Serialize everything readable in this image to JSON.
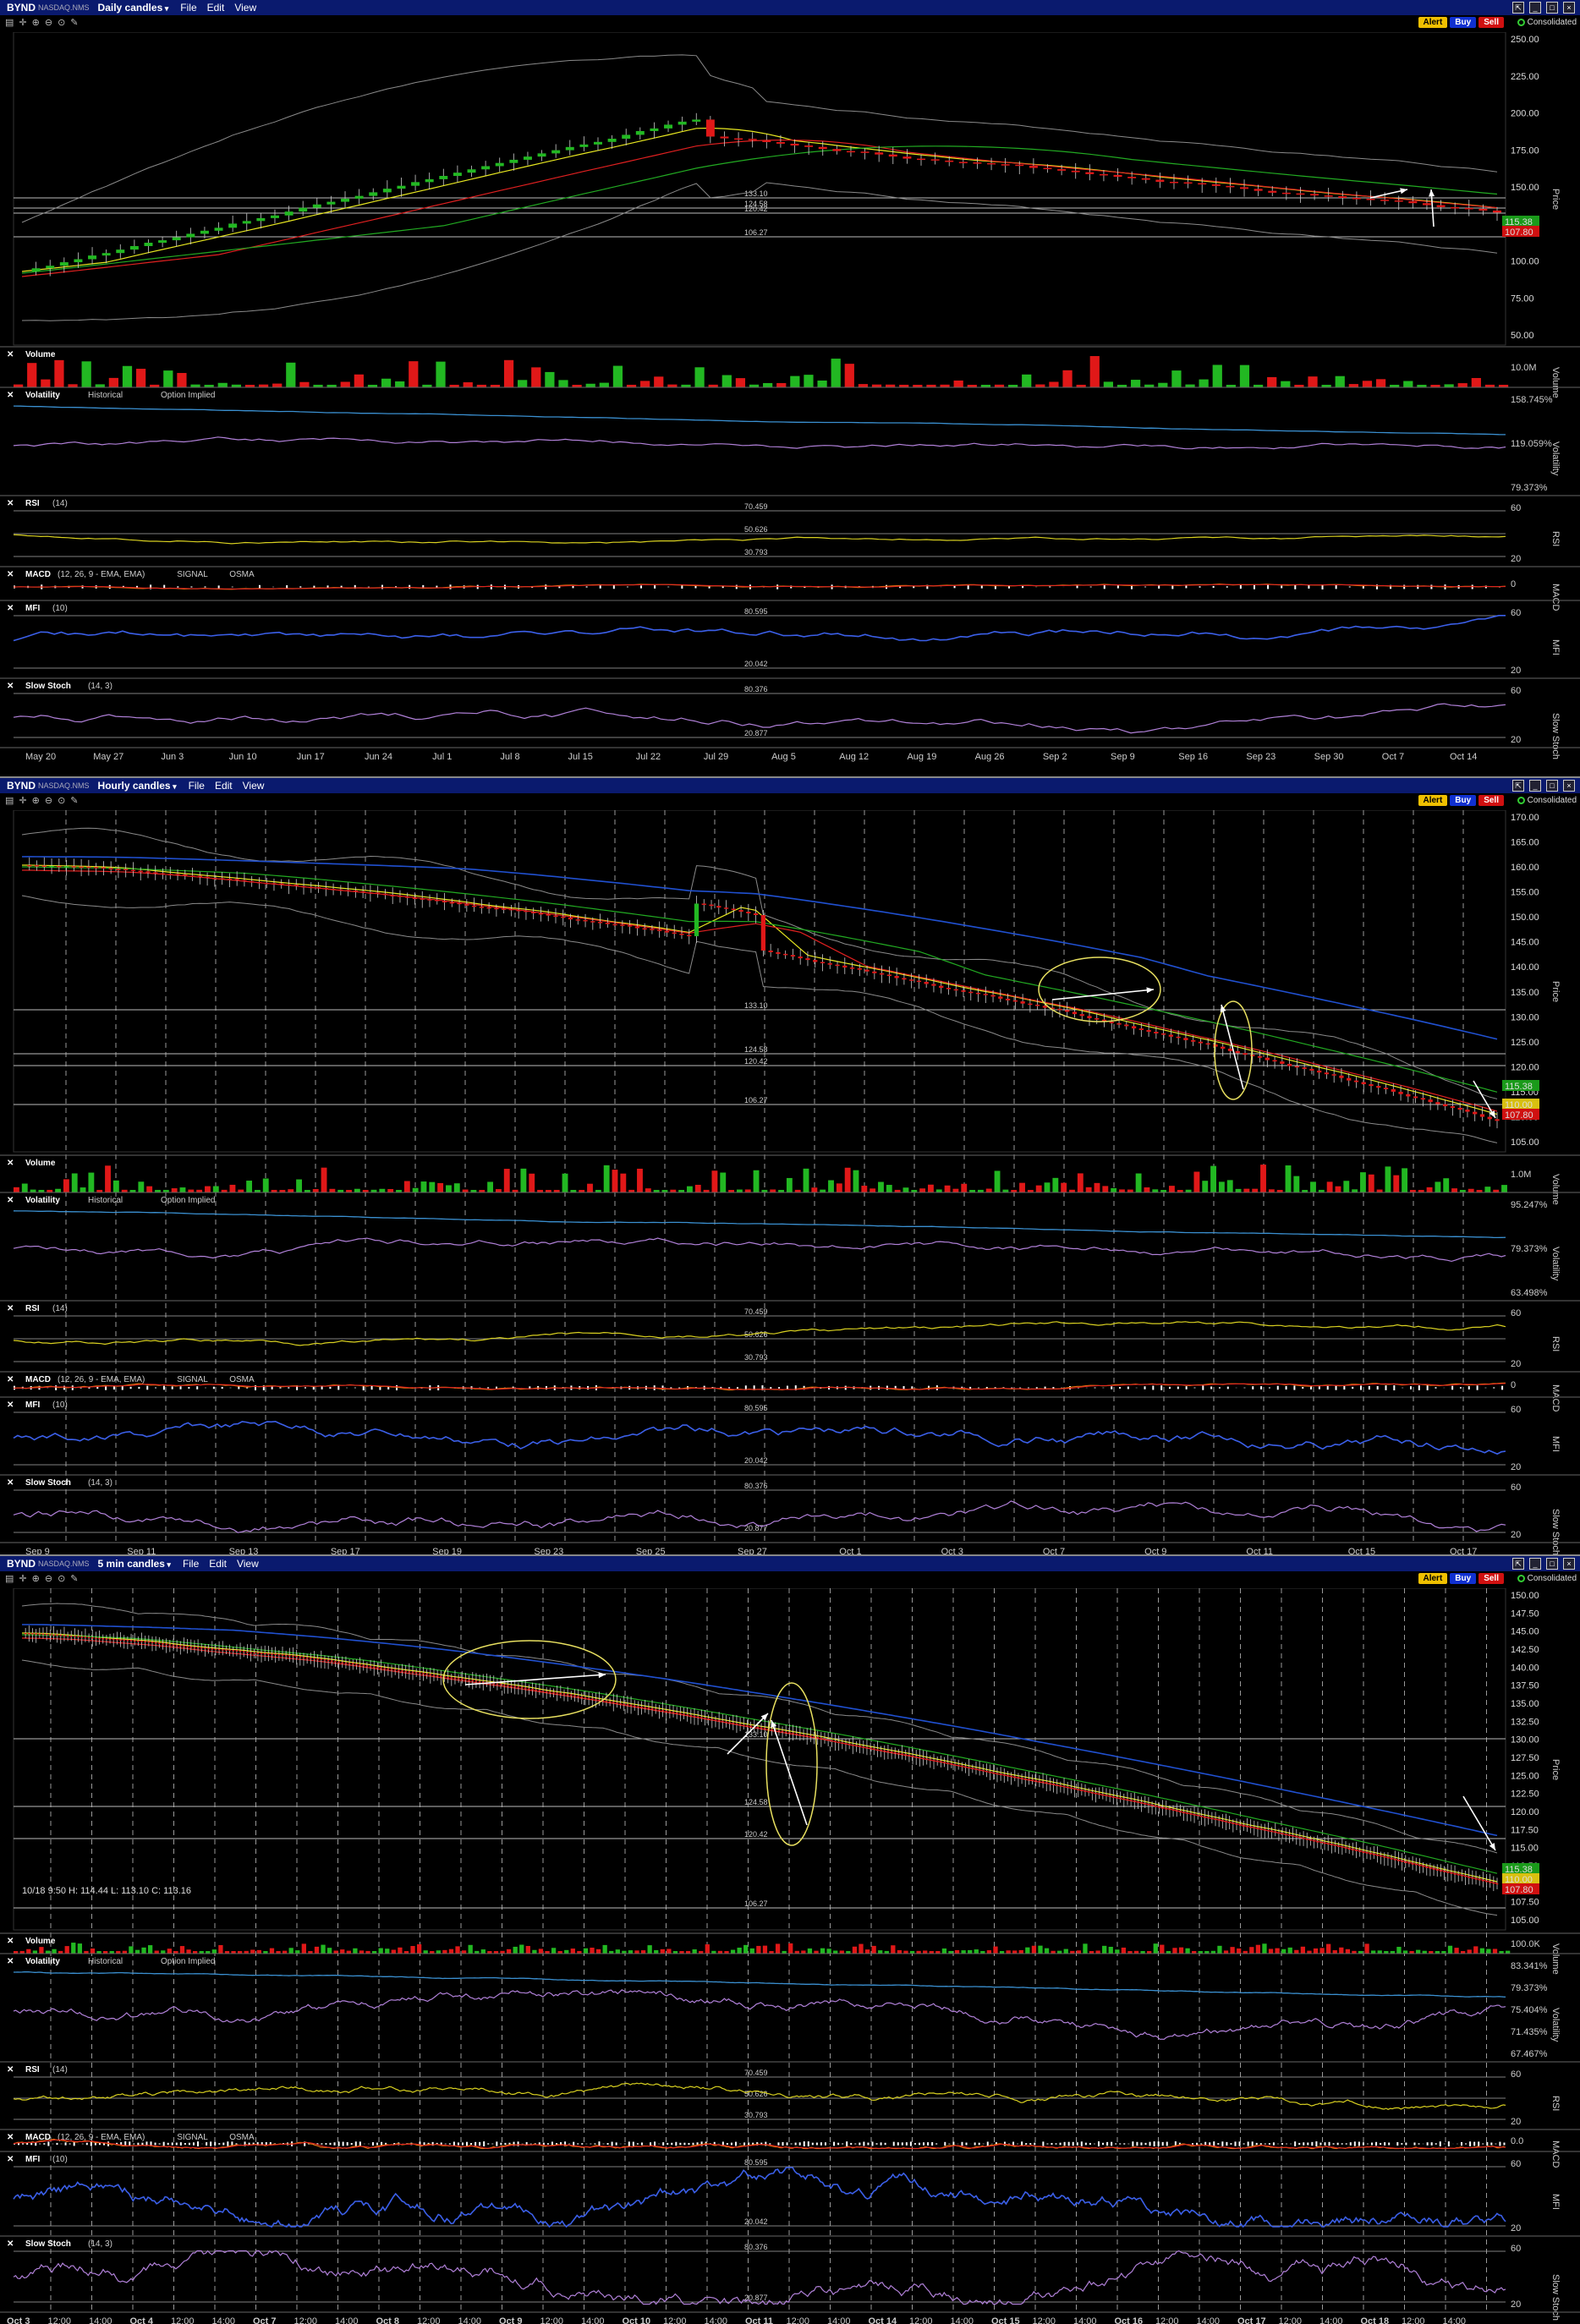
{
  "windows": [
    {
      "symbol": "BYND",
      "exchange": "NASDAQ.NMS",
      "chart_type": "Daily candles",
      "menus": [
        "File",
        "Edit",
        "View"
      ],
      "buttons": {
        "alert": "Alert",
        "buy": "Buy",
        "sell": "Sell"
      },
      "feed": "Consolidated",
      "price_axis": {
        "labels": [
          "250.00",
          "225.00",
          "200.00",
          "175.00",
          "150.00",
          "125.00",
          "100.00",
          "75.00",
          "50.00"
        ],
        "title": "Price",
        "last_price": "115.38",
        "bid_price": "107.80"
      },
      "hlines": [
        "133.10",
        "124.58",
        "120.42",
        "106.27"
      ],
      "panes": [
        {
          "name": "Volume",
          "params": "",
          "axis": [
            "10.0M"
          ],
          "axis_title": "Volume"
        },
        {
          "name": "Volatility",
          "params": "",
          "legend": [
            "Historical",
            "Option Implied"
          ],
          "axis": [
            "158.745%",
            "119.059%",
            "79.373%"
          ],
          "axis_title": "Volatility"
        },
        {
          "name": "RSI",
          "params": "(14)",
          "levels": [
            "70.459",
            "50.626",
            "30.793"
          ],
          "axis": [
            "60",
            "20"
          ],
          "axis_title": "RSI"
        },
        {
          "name": "MACD",
          "params": "(12, 26, 9 - EMA, EMA)",
          "legend": [
            "SIGNAL",
            "OSMA"
          ],
          "axis": [
            "0"
          ],
          "axis_title": "MACD"
        },
        {
          "name": "MFI",
          "params": "(10)",
          "levels": [
            "80.595",
            "20.042"
          ],
          "axis": [
            "60",
            "20"
          ],
          "axis_title": "MFI"
        },
        {
          "name": "Slow Stoch",
          "params": "(14, 3)",
          "levels": [
            "80.376",
            "20.877"
          ],
          "axis": [
            "60",
            "20"
          ],
          "axis_title": "Slow Stoch"
        }
      ],
      "x_labels": [
        "May 20",
        "May 27",
        "Jun 3",
        "Jun 10",
        "Jun 17",
        "Jun 24",
        "Jul 1",
        "Jul 8",
        "Jul 15",
        "Jul 22",
        "Jul 29",
        "Aug 5",
        "Aug 12",
        "Aug 19",
        "Aug 26",
        "Sep 2",
        "Sep 9",
        "Sep 16",
        "Sep 23",
        "Sep 30",
        "Oct 7",
        "Oct 14"
      ]
    },
    {
      "symbol": "BYND",
      "exchange": "NASDAQ.NMS",
      "chart_type": "Hourly candles",
      "menus": [
        "File",
        "Edit",
        "View"
      ],
      "buttons": {
        "alert": "Alert",
        "buy": "Buy",
        "sell": "Sell"
      },
      "feed": "Consolidated",
      "price_axis": {
        "labels": [
          "170.00",
          "165.00",
          "160.00",
          "155.00",
          "150.00",
          "145.00",
          "140.00",
          "135.00",
          "130.00",
          "125.00",
          "120.00",
          "115.00",
          "110.00",
          "105.00"
        ],
        "title": "Price",
        "last_price": "115.38",
        "mid_price": "110.00",
        "bid_price": "107.80"
      },
      "hlines": [
        "133.10",
        "124.58",
        "120.42",
        "106.27"
      ],
      "panes": [
        {
          "name": "Volume",
          "params": "",
          "axis": [
            "1.0M"
          ],
          "axis_title": "Volume"
        },
        {
          "name": "Volatility",
          "params": "",
          "legend": [
            "Historical",
            "Option Implied"
          ],
          "axis": [
            "95.247%",
            "79.373%",
            "63.498%"
          ],
          "axis_title": "Volatility"
        },
        {
          "name": "RSI",
          "params": "(14)",
          "levels": [
            "70.459",
            "50.626",
            "30.793"
          ],
          "axis": [
            "60",
            "20"
          ],
          "axis_title": "RSI"
        },
        {
          "name": "MACD",
          "params": "(12, 26, 9 - EMA, EMA)",
          "legend": [
            "SIGNAL",
            "OSMA"
          ],
          "axis": [
            "0"
          ],
          "axis_title": "MACD"
        },
        {
          "name": "MFI",
          "params": "(10)",
          "levels": [
            "80.595",
            "20.042"
          ],
          "axis": [
            "60",
            "20"
          ],
          "axis_title": "MFI"
        },
        {
          "name": "Slow Stoch",
          "params": "(14, 3)",
          "levels": [
            "80.376",
            "20.877"
          ],
          "axis": [
            "60",
            "20"
          ],
          "axis_title": "Slow Stoch"
        }
      ],
      "x_labels": [
        "Sep 9",
        "Sep 11",
        "Sep 13",
        "Sep 17",
        "Sep 19",
        "Sep 23",
        "Sep 25",
        "Sep 27",
        "Oct 1",
        "Oct 3",
        "Oct 7",
        "Oct 9",
        "Oct 11",
        "Oct 15",
        "Oct 17"
      ]
    },
    {
      "symbol": "BYND",
      "exchange": "NASDAQ.NMS",
      "chart_type": "5 min candles",
      "menus": [
        "File",
        "Edit",
        "View"
      ],
      "buttons": {
        "alert": "Alert",
        "buy": "Buy",
        "sell": "Sell"
      },
      "feed": "Consolidated",
      "price_axis": {
        "labels": [
          "150.00",
          "147.50",
          "145.00",
          "142.50",
          "140.00",
          "137.50",
          "135.00",
          "132.50",
          "130.00",
          "127.50",
          "125.00",
          "122.50",
          "120.00",
          "117.50",
          "115.00",
          "112.50",
          "110.00",
          "107.50",
          "105.00"
        ],
        "title": "Price",
        "last_price": "115.38",
        "mid_price": "110.00",
        "bid_price": "107.80"
      },
      "hlines": [
        "133.10",
        "124.58",
        "120.42",
        "106.27"
      ],
      "ohlc_readout": "10/18 9:50    H: 114.44    L: 113.10    C: 113.16",
      "panes": [
        {
          "name": "Volume",
          "params": "",
          "axis": [
            "100.0K"
          ],
          "axis_title": "Volume"
        },
        {
          "name": "Volatility",
          "params": "",
          "legend": [
            "Historical",
            "Option Implied"
          ],
          "axis": [
            "83.341%",
            "79.373%",
            "75.404%",
            "71.435%",
            "67.467%"
          ],
          "axis_title": "Volatility"
        },
        {
          "name": "RSI",
          "params": "(14)",
          "levels": [
            "70.459",
            "50.626",
            "30.793"
          ],
          "axis": [
            "60",
            "20"
          ],
          "axis_title": "RSI"
        },
        {
          "name": "MACD",
          "params": "(12, 26, 9 - EMA, EMA)",
          "legend": [
            "SIGNAL",
            "OSMA"
          ],
          "axis": [
            "0.0"
          ],
          "axis_title": "MACD"
        },
        {
          "name": "MFI",
          "params": "(10)",
          "levels": [
            "80.595",
            "20.042"
          ],
          "axis": [
            "60",
            "20"
          ],
          "axis_title": "MFI"
        },
        {
          "name": "Slow Stoch",
          "params": "(14, 3)",
          "levels": [
            "80.376",
            "20.877"
          ],
          "axis": [
            "60",
            "20"
          ],
          "axis_title": "Slow Stoch"
        }
      ],
      "x_labels": [
        "Oct 3",
        "12:00",
        "14:00",
        "Oct 4",
        "12:00",
        "14:00",
        "Oct 7",
        "12:00",
        "14:00",
        "Oct 8",
        "12:00",
        "14:00",
        "Oct 9",
        "12:00",
        "14:00",
        "Oct 10",
        "12:00",
        "14:00",
        "Oct 11",
        "12:00",
        "14:00",
        "Oct 14",
        "12:00",
        "14:00",
        "Oct 15",
        "12:00",
        "14:00",
        "Oct 16",
        "12:00",
        "14:00",
        "Oct 17",
        "12:00",
        "14:00",
        "Oct 18",
        "12:00",
        "14:00"
      ]
    }
  ],
  "colors": {
    "up": "#22b822",
    "down": "#e01818",
    "bollinger": "#8a8a8a",
    "ema_short": "#e8e820",
    "ema_mid": "#e02020",
    "ema_long": "#22aa22",
    "sma_long": "#2050d0",
    "historical_vol": "#3a8fd0",
    "implied_vol": "#b080d8",
    "rsi": "#d8d020",
    "mfi": "#3b5fe8",
    "stoch": "#b080d8",
    "annotation": "#e8e060",
    "bg": "#000000",
    "title_bg": "#0a1a6e"
  }
}
